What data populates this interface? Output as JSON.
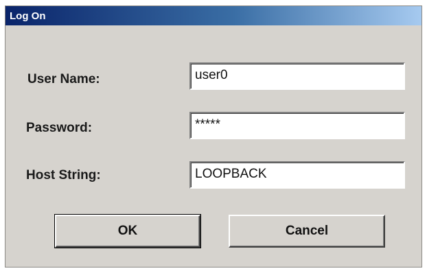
{
  "window": {
    "title": "Log On"
  },
  "form": {
    "username": {
      "label": "User Name:",
      "value": "user0"
    },
    "password": {
      "label": "Password:",
      "value": "*****"
    },
    "host": {
      "label": "Host String:",
      "value": "LOOPBACK"
    }
  },
  "buttons": {
    "ok_label": "OK",
    "cancel_label": "Cancel"
  },
  "colors": {
    "face": "#d6d3ce",
    "title_start": "#0a246a",
    "title_end": "#a6caf0"
  }
}
